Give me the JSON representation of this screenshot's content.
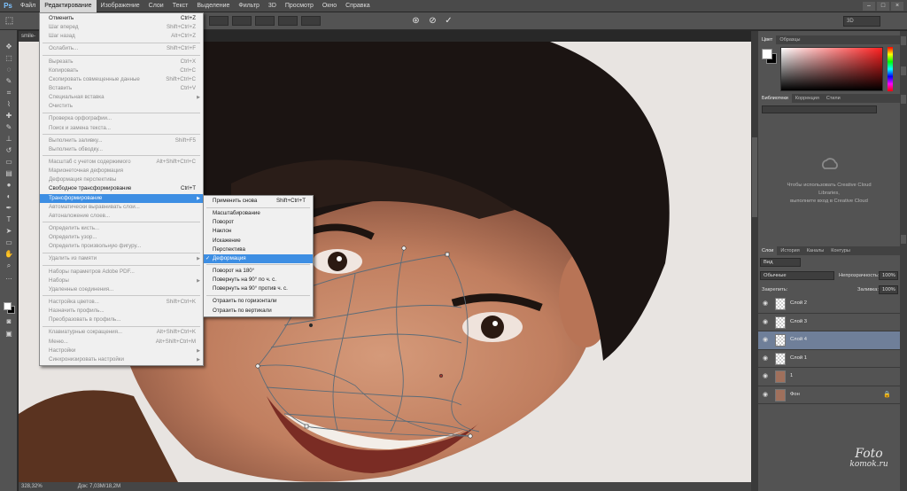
{
  "app": {
    "logo": "Ps"
  },
  "menubar": {
    "items": [
      "Файл",
      "Редактирование",
      "Изображение",
      "Слои",
      "Текст",
      "Выделение",
      "Фильтр",
      "3D",
      "Просмотр",
      "Окно",
      "Справка"
    ],
    "active_index": 1
  },
  "options": {
    "workspace": "3D"
  },
  "document": {
    "tab_label": "smile-",
    "zoom": "328,32%",
    "doc_info": "Док: 7,03M/18,2M"
  },
  "edit_menu": {
    "items": [
      {
        "label": "Отменить",
        "shortcut": "Ctrl+Z",
        "disabled": false
      },
      {
        "label": "Шаг вперед",
        "shortcut": "Shift+Ctrl+Z",
        "disabled": true
      },
      {
        "label": "Шаг назад",
        "shortcut": "Alt+Ctrl+Z",
        "disabled": true
      },
      {
        "sep": true
      },
      {
        "label": "Ослабить...",
        "shortcut": "Shift+Ctrl+F",
        "disabled": true
      },
      {
        "sep": true
      },
      {
        "label": "Вырезать",
        "shortcut": "Ctrl+X",
        "disabled": true
      },
      {
        "label": "Копировать",
        "shortcut": "Ctrl+C",
        "disabled": true
      },
      {
        "label": "Скопировать совмещенные данные",
        "shortcut": "Shift+Ctrl+C",
        "disabled": true
      },
      {
        "label": "Вставить",
        "shortcut": "Ctrl+V",
        "disabled": true
      },
      {
        "label": "Специальная вставка",
        "shortcut": "",
        "submenu": true,
        "disabled": true
      },
      {
        "label": "Очистить",
        "shortcut": "",
        "disabled": true
      },
      {
        "sep": true
      },
      {
        "label": "Проверка орфографии...",
        "shortcut": "",
        "disabled": true
      },
      {
        "label": "Поиск и замена текста...",
        "shortcut": "",
        "disabled": true
      },
      {
        "sep": true
      },
      {
        "label": "Выполнить заливку...",
        "shortcut": "Shift+F5",
        "disabled": true
      },
      {
        "label": "Выполнить обводку...",
        "shortcut": "",
        "disabled": true
      },
      {
        "sep": true
      },
      {
        "label": "Масштаб с учетом содержимого",
        "shortcut": "Alt+Shift+Ctrl+C",
        "disabled": true
      },
      {
        "label": "Марионеточная деформация",
        "shortcut": "",
        "disabled": true
      },
      {
        "label": "Деформация перспективы",
        "shortcut": "",
        "disabled": true
      },
      {
        "label": "Свободное трансформирование",
        "shortcut": "Ctrl+T",
        "disabled": false
      },
      {
        "label": "Трансформирование",
        "shortcut": "",
        "submenu": true,
        "highlighted": true,
        "disabled": false
      },
      {
        "label": "Автоматически выравнивать слои...",
        "shortcut": "",
        "disabled": true
      },
      {
        "label": "Автоналожение слоев...",
        "shortcut": "",
        "disabled": true
      },
      {
        "sep": true
      },
      {
        "label": "Определить кисть...",
        "shortcut": "",
        "disabled": true
      },
      {
        "label": "Определить узор...",
        "shortcut": "",
        "disabled": true
      },
      {
        "label": "Определить произвольную фигуру...",
        "shortcut": "",
        "disabled": true
      },
      {
        "sep": true
      },
      {
        "label": "Удалить из памяти",
        "shortcut": "",
        "submenu": true,
        "disabled": true
      },
      {
        "sep": true
      },
      {
        "label": "Наборы параметров Adobe PDF...",
        "shortcut": "",
        "disabled": true
      },
      {
        "label": "Наборы",
        "shortcut": "",
        "submenu": true,
        "disabled": true
      },
      {
        "label": "Удаленные соединения...",
        "shortcut": "",
        "disabled": true
      },
      {
        "sep": true
      },
      {
        "label": "Настройка цветов...",
        "shortcut": "Shift+Ctrl+K",
        "disabled": true
      },
      {
        "label": "Назначить профиль...",
        "shortcut": "",
        "disabled": true
      },
      {
        "label": "Преобразовать в профиль...",
        "shortcut": "",
        "disabled": true
      },
      {
        "sep": true
      },
      {
        "label": "Клавиатурные сокращения...",
        "shortcut": "Alt+Shift+Ctrl+K",
        "disabled": true
      },
      {
        "label": "Меню...",
        "shortcut": "Alt+Shift+Ctrl+M",
        "disabled": true
      },
      {
        "label": "Настройки",
        "shortcut": "",
        "submenu": true,
        "disabled": true
      },
      {
        "label": "Синхронизировать настройки",
        "shortcut": "",
        "submenu": true,
        "disabled": true
      }
    ]
  },
  "transform_menu": {
    "items": [
      {
        "label": "Применить снова",
        "shortcut": "Shift+Ctrl+T"
      },
      {
        "sep": true
      },
      {
        "label": "Масштабирование",
        "shortcut": ""
      },
      {
        "label": "Поворот",
        "shortcut": ""
      },
      {
        "label": "Наклон",
        "shortcut": ""
      },
      {
        "label": "Искажение",
        "shortcut": ""
      },
      {
        "label": "Перспектива",
        "shortcut": ""
      },
      {
        "label": "Деформация",
        "shortcut": "",
        "highlighted": true,
        "checked": true
      },
      {
        "sep": true
      },
      {
        "label": "Поворот на 180°",
        "shortcut": ""
      },
      {
        "label": "Повернуть на 90° по ч. с.",
        "shortcut": ""
      },
      {
        "label": "Повернуть на 90° против ч. с.",
        "shortcut": ""
      },
      {
        "sep": true
      },
      {
        "label": "Отразить по горизонтали",
        "shortcut": ""
      },
      {
        "label": "Отразить по вертикали",
        "shortcut": ""
      }
    ]
  },
  "panels": {
    "color_tabs": [
      "Цвет",
      "Образцы"
    ],
    "library_tabs": [
      "Библиотеки",
      "Коррекция",
      "Стили"
    ],
    "library_message_1": "Чтобы использовать Creative Cloud",
    "library_message_2": "Libraries,",
    "library_message_3": "выполните вход в Creative Cloud",
    "layers_tabs": [
      "Слои",
      "История",
      "Каналы",
      "Контуры"
    ],
    "kind_filter": "Вид",
    "blend_mode": "Обычные",
    "opacity_label": "Непрозрачность:",
    "opacity_value": "100%",
    "lock_label": "Закрепить:",
    "fill_label": "Заливка:",
    "fill_value": "100%",
    "layers": [
      {
        "name": "Слой 2",
        "selected": false,
        "photo": false
      },
      {
        "name": "Слой 3",
        "selected": false,
        "photo": false
      },
      {
        "name": "Слой 4",
        "selected": true,
        "photo": false
      },
      {
        "name": "Слой 1",
        "selected": false,
        "photo": false
      },
      {
        "name": "1",
        "selected": false,
        "photo": true
      },
      {
        "name": "Фон",
        "selected": false,
        "photo": true,
        "locked": true
      }
    ]
  },
  "watermark": {
    "line1": "Foto",
    "line2": "komok.ru"
  },
  "colors": {
    "menu_highlight": "#3d8ee3",
    "layer_selected": "#6f7f99",
    "canvas_bg": "#e8e4e1"
  }
}
